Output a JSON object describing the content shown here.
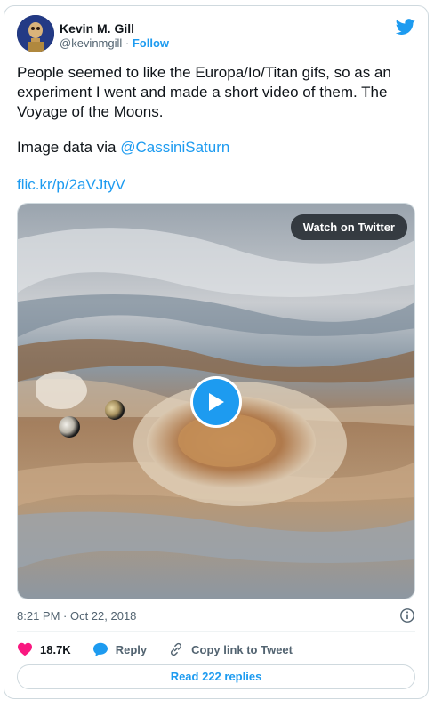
{
  "author": {
    "name": "Kevin M. Gill",
    "handle": "@kevinmgill",
    "separator": " · ",
    "follow_label": "Follow"
  },
  "tweet": {
    "lines": [
      "People seemed to like the Europa/Io/Titan gifs, so as an",
      "experiment I went and made a short video of them. The",
      "Voyage of the Moons."
    ],
    "image_credit_prefix": "Image data via ",
    "image_credit_mention": "@CassiniSaturn",
    "link": "flic.kr/p/2aVJtyV"
  },
  "media": {
    "watch_label": "Watch on Twitter"
  },
  "meta": {
    "timestamp": "8:21 PM · Oct 22, 2018"
  },
  "actions": {
    "likes": "18.7K",
    "reply_label": "Reply",
    "copy_label": "Copy link to Tweet"
  },
  "read_replies_label": "Read 222 replies",
  "colors": {
    "accent": "#1d9bf0",
    "like": "#f91880"
  }
}
